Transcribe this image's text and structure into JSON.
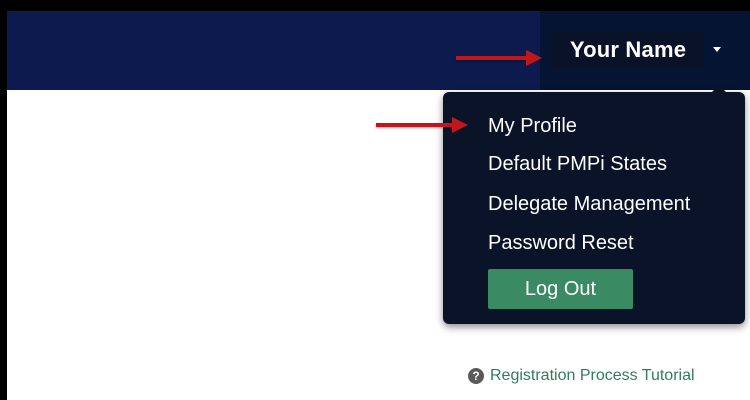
{
  "header": {
    "user_name": "Your Name"
  },
  "user_menu": {
    "items": [
      {
        "label": "My Profile"
      },
      {
        "label": "Default PMPi States"
      },
      {
        "label": "Delegate Management"
      },
      {
        "label": "Password Reset"
      }
    ],
    "logout_label": "Log Out"
  },
  "footer": {
    "tutorial_label": "Registration Process Tutorial",
    "help_icon_glyph": "?"
  },
  "icons": {
    "help": "question-circle-icon",
    "dropdown": "caret-down-icon",
    "annotation": "red-arrow-icon"
  },
  "colors": {
    "header_bg": "#0c1a4e",
    "menu_bg": "#0a1328",
    "logout_bg": "#3a8a63",
    "link": "#2f7d5e",
    "annotation_arrow": "#c1171c"
  }
}
